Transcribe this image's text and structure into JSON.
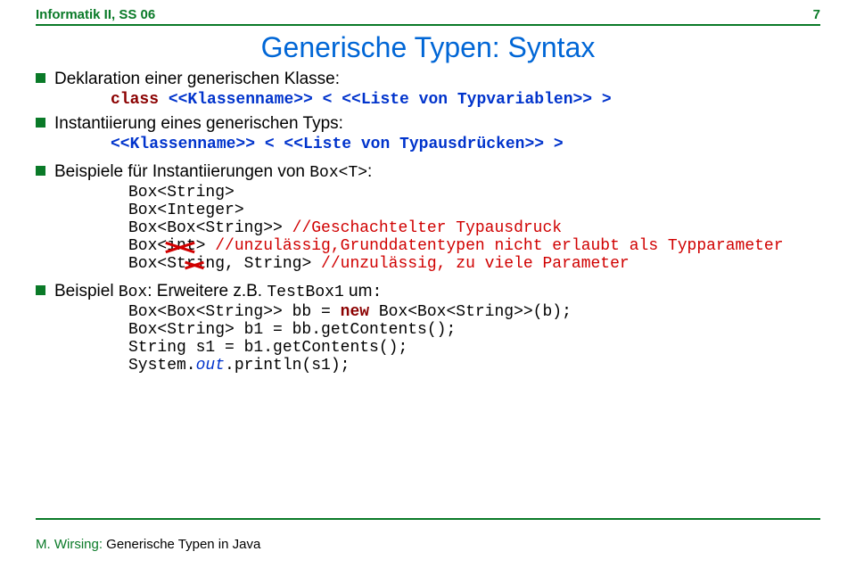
{
  "header": {
    "left": "Informatik II, SS 06",
    "pagenum": "7"
  },
  "title": "Generische Typen: Syntax",
  "b1": {
    "text": "Deklaration einer generischen Klasse:"
  },
  "c1": {
    "kw": "class",
    "rest": " <<Klassenname>> < <<Liste von Typvariablen>> >"
  },
  "b2": {
    "text": "Instantiierung eines generischen Typs:"
  },
  "c2": {
    "line": "<<Klassenname>> < <<Liste von Typausdrücken>> >"
  },
  "b3": {
    "pre": "Beispiele für Instantiierungen von ",
    "code": "Box<T>",
    "post": ":"
  },
  "ex": {
    "l1": "Box<String>",
    "l2": "Box<Integer>",
    "l3a": "Box<Box<String>> ",
    "l3b": "//Geschachtelter Typausdruck",
    "l4a": "Box<",
    "l4x": "int",
    "l4b": ">  ",
    "l4c": "//unzulässig,Grunddatentypen nicht erlaubt als Typparameter",
    "l5a": "Box<St",
    "l5x": "ri",
    "l5b": "ng, String> ",
    "l5c": "//unzulässig, zu viele Parameter"
  },
  "b4": {
    "pre": "Beispiel ",
    "code1": "Box",
    "mid": ": Erweitere z.B. ",
    "code2": "TestBox1",
    "mid2": " um",
    ":": ":"
  },
  "prog": {
    "l1a": "Box<Box<String>> bb = ",
    "l1kw": "new",
    "l1b": " Box<Box<String>>(b);",
    "l2": "Box<String> b1 = bb.getContents();",
    "l3": "String s1 =  b1.getContents();",
    "l4a": "System.",
    "l4i": "out",
    "l4b": ".println(s1);"
  },
  "footer": {
    "auth": "M. Wirsing: ",
    "title": "Generische Typen in Java"
  }
}
